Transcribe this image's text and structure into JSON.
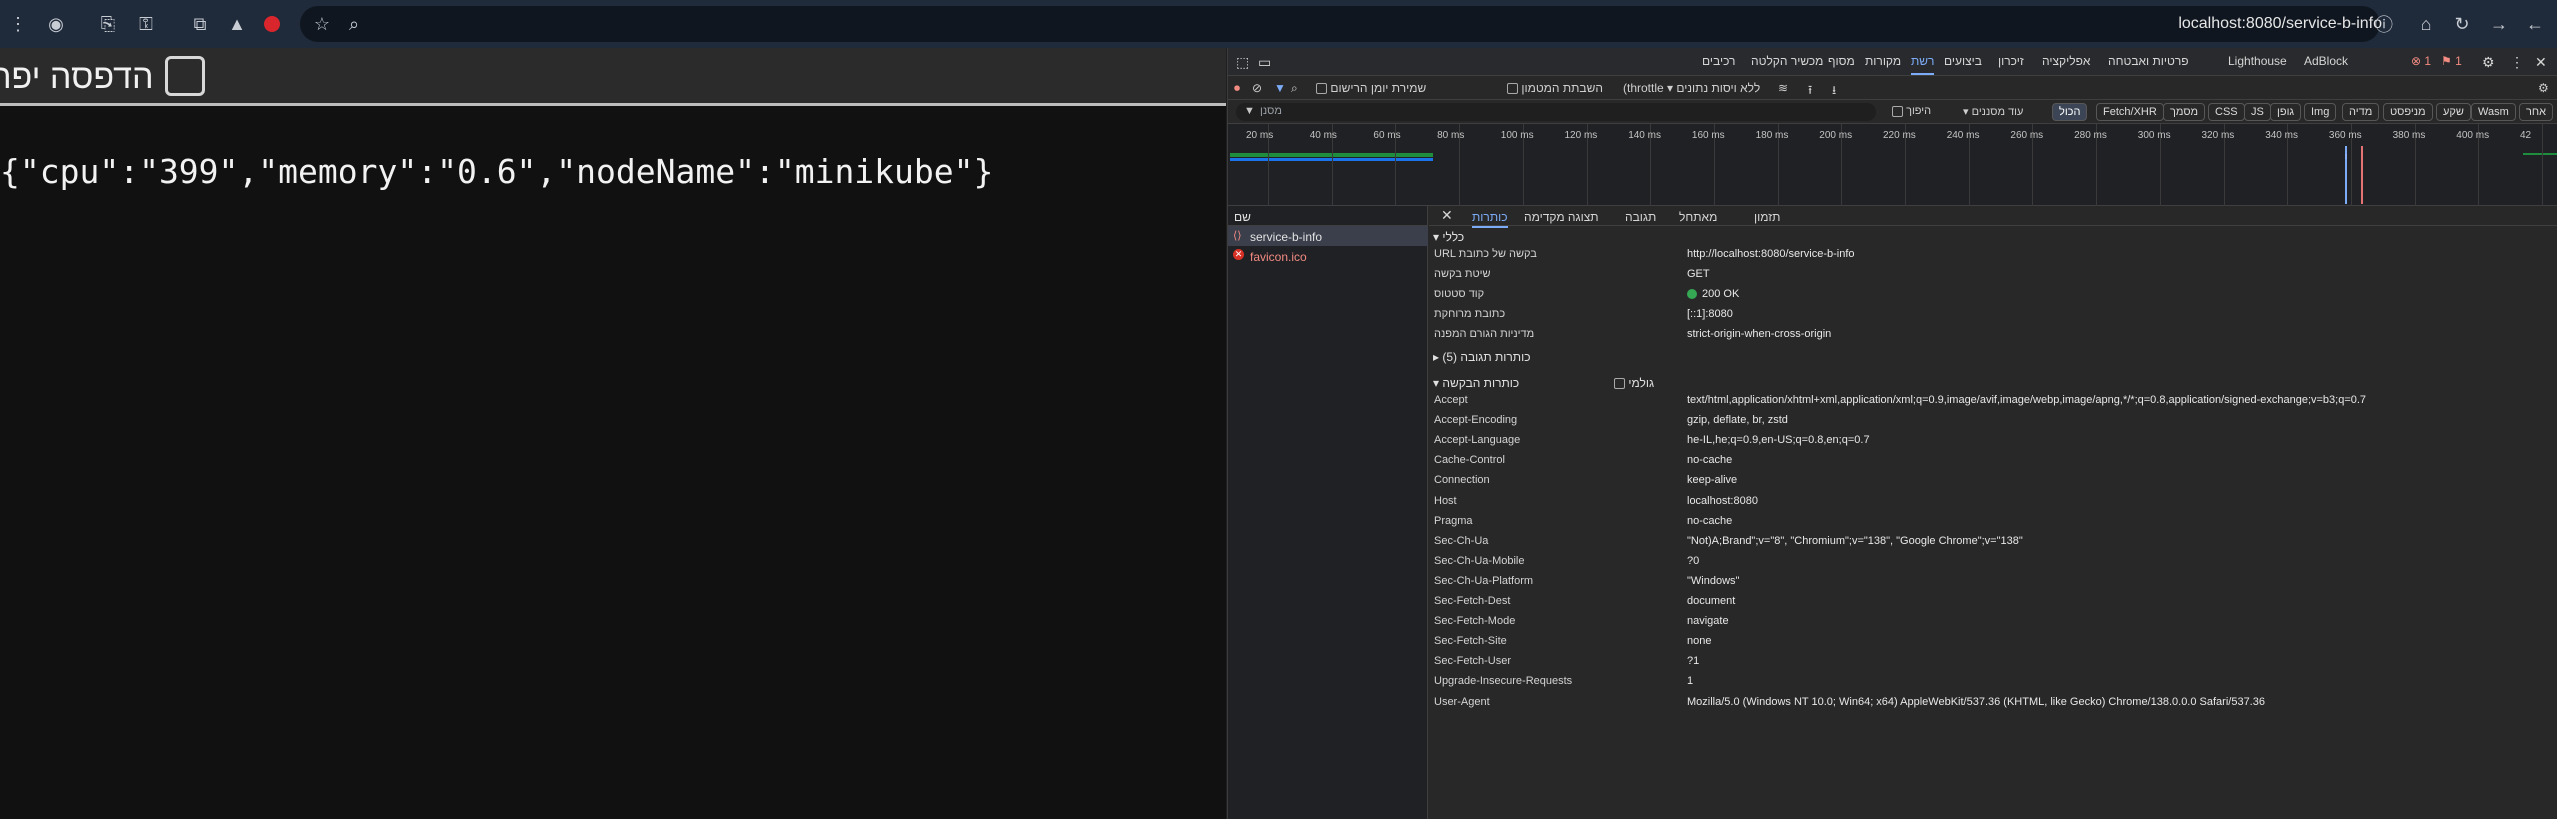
{
  "browser": {
    "url": "localhost:8080/service-b-info"
  },
  "page": {
    "print_label": "הדפסה יפה",
    "json_text": "{\"cpu\":\"399\",\"memory\":\"0.6\",\"nodeName\":\"minikube\"}"
  },
  "devtools": {
    "tabs": [
      "רכיבים",
      "מכשיר הקלטה",
      "מסוף",
      "מקורות",
      "רשת",
      "ביצועים",
      "זיכרון",
      "אפליקציה",
      "פרטיות ואבטחה",
      "Lighthouse",
      "AdBlock"
    ],
    "active_tab": "רשת",
    "errors_count": "1",
    "issues_count": "1",
    "toolbar": {
      "preserve_log": "שמירת יומן הרישום",
      "disable_cache": "השבתת המטמון",
      "throttle": "ללא ויסות נתונים"
    },
    "filter": {
      "placeholder": "מסנן",
      "invert": "היפוך",
      "more_filters": "עוד מסננים",
      "chips": [
        "הכול",
        "Fetch/XHR",
        "מסמך",
        "CSS",
        "JS",
        "גופן",
        "Img",
        "מדיה",
        "מניפסט",
        "שקע",
        "Wasm",
        "אחר"
      ],
      "active_chip": "הכול"
    },
    "timeline_ticks": [
      "20 ms",
      "40 ms",
      "60 ms",
      "80 ms",
      "100 ms",
      "120 ms",
      "140 ms",
      "160 ms",
      "180 ms",
      "200 ms",
      "220 ms",
      "240 ms",
      "260 ms",
      "280 ms",
      "300 ms",
      "320 ms",
      "340 ms",
      "360 ms",
      "380 ms",
      "400 ms",
      "42"
    ],
    "requests_header": "שם",
    "requests": [
      {
        "name": "service-b-info",
        "selected": true,
        "error": false
      },
      {
        "name": "favicon.ico",
        "selected": false,
        "error": true
      }
    ],
    "detail_tabs": [
      "כותרות",
      "תצוגה מקדימה",
      "תגובה",
      "מאתחל",
      "תזמון"
    ],
    "active_detail_tab": "כותרות",
    "general": {
      "title": "כללי",
      "rows": [
        {
          "key": "URL בקשה של כתובת",
          "value": "http://localhost:8080/service-b-info"
        },
        {
          "key": "שיטת בקשה",
          "value": "GET"
        },
        {
          "key": "קוד סטטוס",
          "value": "200 OK"
        },
        {
          "key": "כתובת מרוחקת",
          "value": "[::1]:8080"
        },
        {
          "key": "מדיניות הגורם המפנה",
          "value": "strict-origin-when-cross-origin"
        }
      ]
    },
    "response_headers_title": "כותרות תגובה (5)",
    "request_headers_title": "כותרות הבקשה",
    "raw_label": "גולמי",
    "request_headers": [
      {
        "key": "Accept",
        "value": "text/html,application/xhtml+xml,application/xml;q=0.9,image/avif,image/webp,image/apng,*/*;q=0.8,application/signed-exchange;v=b3;q=0.7"
      },
      {
        "key": "Accept-Encoding",
        "value": "gzip, deflate, br, zstd"
      },
      {
        "key": "Accept-Language",
        "value": "he-IL,he;q=0.9,en-US;q=0.8,en;q=0.7"
      },
      {
        "key": "Cache-Control",
        "value": "no-cache"
      },
      {
        "key": "Connection",
        "value": "keep-alive"
      },
      {
        "key": "Host",
        "value": "localhost:8080"
      },
      {
        "key": "Pragma",
        "value": "no-cache"
      },
      {
        "key": "Sec-Ch-Ua",
        "value": "\"Not)A;Brand\";v=\"8\", \"Chromium\";v=\"138\", \"Google Chrome\";v=\"138\""
      },
      {
        "key": "Sec-Ch-Ua-Mobile",
        "value": "?0"
      },
      {
        "key": "Sec-Ch-Ua-Platform",
        "value": "\"Windows\""
      },
      {
        "key": "Sec-Fetch-Dest",
        "value": "document"
      },
      {
        "key": "Sec-Fetch-Mode",
        "value": "navigate"
      },
      {
        "key": "Sec-Fetch-Site",
        "value": "none"
      },
      {
        "key": "Sec-Fetch-User",
        "value": "?1"
      },
      {
        "key": "Upgrade-Insecure-Requests",
        "value": "1"
      },
      {
        "key": "User-Agent",
        "value": "Mozilla/5.0 (Windows NT 10.0; Win64; x64) AppleWebKit/537.36 (KHTML, like Gecko) Chrome/138.0.0.0 Safari/537.36"
      }
    ]
  }
}
